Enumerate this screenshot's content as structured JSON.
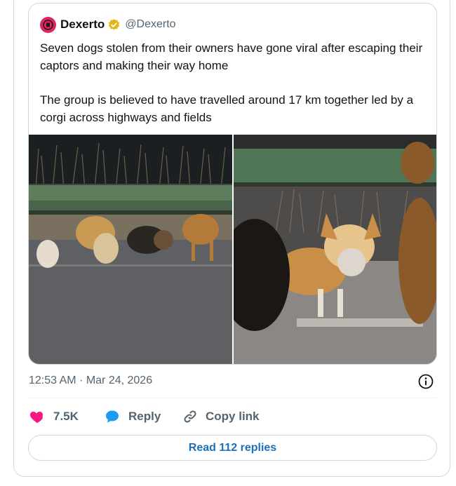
{
  "quoted_tweet": {
    "display_name": "Dexerto",
    "handle": "@Dexerto",
    "text_paragraphs": [
      "Seven dogs stolen from their owners have gone viral after escaping their captors and making their way home",
      "The group is believed to have travelled around 17 km together led by a corgi across highways and fields"
    ],
    "media": [
      {
        "icon": "dog-group-photo"
      },
      {
        "icon": "corgi-photo"
      }
    ]
  },
  "meta": {
    "timestamp": "12:53 AM · Mar 24, 2026"
  },
  "actions": {
    "like_count": "7.5K",
    "reply_label": "Reply",
    "copy_label": "Copy link"
  },
  "read_replies_label": "Read 112 replies",
  "colors": {
    "like": "#f91880",
    "reply": "#1d9bf0",
    "verified": "#e2b719",
    "link": "#1d6fb8",
    "border": "#cfd9de"
  }
}
